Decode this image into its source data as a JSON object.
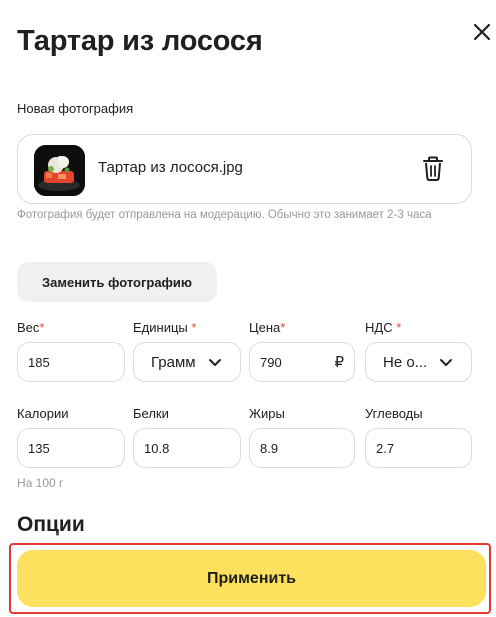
{
  "dialog": {
    "title": "Тартар из лосося",
    "close_icon": "close-icon"
  },
  "photo": {
    "label": "Новая фотография",
    "file_name": "Тартар из лосося.jpg",
    "delete_icon": "trash-icon",
    "hint": "Фотография будет отправлена на модерацию. Обычно это занимает 2-3 часа",
    "replace_label": "Заменить фотографию"
  },
  "fields_row1": {
    "weight": {
      "label": "Вес",
      "required_mark": "*",
      "value": "185"
    },
    "units": {
      "label": "Единицы",
      "required_mark": "*",
      "value": "Грамм"
    },
    "price": {
      "label": "Цена",
      "required_mark": "*",
      "value": "790",
      "currency": "₽"
    },
    "vat": {
      "label": "НДС",
      "required_mark": "*",
      "value": "Не о..."
    }
  },
  "fields_row2": {
    "calories": {
      "label": "Калории",
      "value": "135"
    },
    "protein": {
      "label": "Белки",
      "value": "10.8"
    },
    "fat": {
      "label": "Жиры",
      "value": "8.9"
    },
    "carbs": {
      "label": "Углеводы",
      "value": "2.7"
    },
    "note": "На 100 г"
  },
  "options": {
    "heading": "Опции"
  },
  "footer": {
    "apply_label": "Применить"
  },
  "colors": {
    "accent": "#fce15f",
    "required": "#e24c3a",
    "highlight": "#e53935"
  }
}
